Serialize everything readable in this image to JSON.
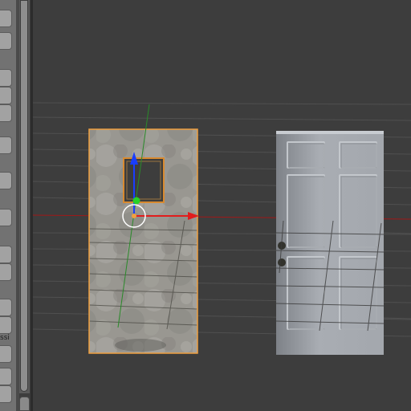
{
  "tool_shelf": {
    "truncated_label": "ssi",
    "button_count": 18
  },
  "viewport": {
    "objects": [
      {
        "name": "textured-plane-selected",
        "texture": "plaster-wall",
        "selected": true
      },
      {
        "name": "door-plane",
        "texture": "white-panel-door",
        "selected": false
      }
    ],
    "manipulator": {
      "x_axis_color": "#e11d1d",
      "y_axis_color": "#28d128",
      "z_axis_color": "#1a3dff"
    },
    "colors": {
      "selection_outline": "#f0a040",
      "grid_line": "#505050",
      "x_axis_line": "#a01818",
      "y_axis_line": "#2a8a2a"
    }
  }
}
